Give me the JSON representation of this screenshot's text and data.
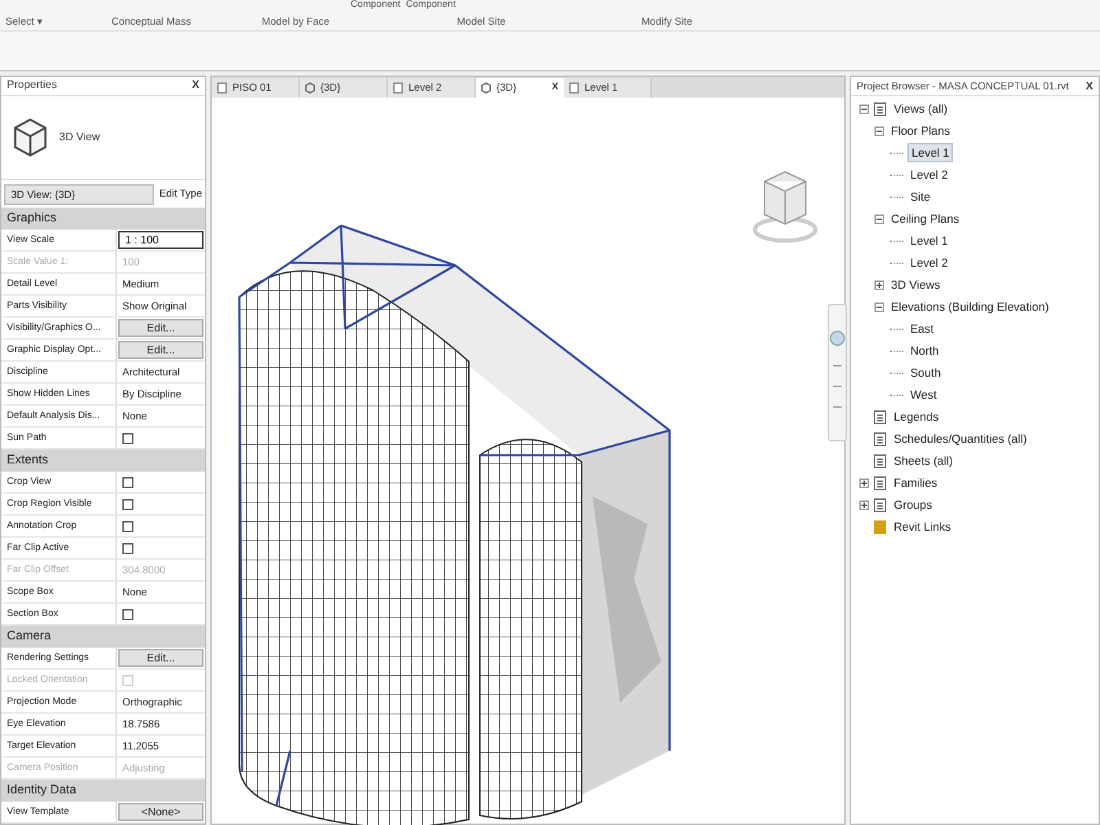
{
  "ribbon": {
    "top_labels": [
      "Component",
      "Component"
    ],
    "panels": [
      {
        "label": "Select ▾"
      },
      {
        "label": "Conceptual Mass"
      },
      {
        "label": "Model by Face"
      },
      {
        "label": "Model Site"
      },
      {
        "label": "Modify Site"
      }
    ]
  },
  "properties": {
    "title": "Properties",
    "close": "X",
    "type_name": "3D View",
    "selector": "3D View: {3D}",
    "edit_type": "Edit Type",
    "rows": [
      {
        "kind": "header",
        "label": "Graphics"
      },
      {
        "kind": "field",
        "label": "View Scale",
        "value": "1 : 100",
        "disabled": false
      },
      {
        "kind": "text",
        "label": "Scale Value  1:",
        "value": "100",
        "disabled": true
      },
      {
        "kind": "text",
        "label": "Detail Level",
        "value": "Medium",
        "disabled": false
      },
      {
        "kind": "text",
        "label": "Parts Visibility",
        "value": "Show Original",
        "disabled": false
      },
      {
        "kind": "button",
        "label": "Visibility/Graphics O...",
        "value": "Edit...",
        "disabled": false
      },
      {
        "kind": "button",
        "label": "Graphic Display Opt...",
        "value": "Edit...",
        "disabled": false
      },
      {
        "kind": "text",
        "label": "Discipline",
        "value": "Architectural",
        "disabled": false
      },
      {
        "kind": "text",
        "label": "Show Hidden Lines",
        "value": "By Discipline",
        "disabled": false
      },
      {
        "kind": "text",
        "label": "Default Analysis Dis...",
        "value": "None",
        "disabled": false
      },
      {
        "kind": "checkbox",
        "label": "Sun Path",
        "checked": false,
        "disabled": false
      },
      {
        "kind": "header",
        "label": "Extents"
      },
      {
        "kind": "checkbox",
        "label": "Crop View",
        "checked": false,
        "disabled": false
      },
      {
        "kind": "checkbox",
        "label": "Crop Region Visible",
        "checked": false,
        "disabled": false
      },
      {
        "kind": "checkbox",
        "label": "Annotation Crop",
        "checked": false,
        "disabled": false
      },
      {
        "kind": "checkbox",
        "label": "Far Clip Active",
        "checked": false,
        "disabled": false
      },
      {
        "kind": "text",
        "label": "Far Clip Offset",
        "value": "304.8000",
        "disabled": true
      },
      {
        "kind": "text",
        "label": "Scope Box",
        "value": "None",
        "disabled": false
      },
      {
        "kind": "checkbox",
        "label": "Section Box",
        "checked": false,
        "disabled": false
      },
      {
        "kind": "header",
        "label": "Camera"
      },
      {
        "kind": "button",
        "label": "Rendering Settings",
        "value": "Edit...",
        "disabled": false
      },
      {
        "kind": "checkbox",
        "label": "Locked Orientation",
        "checked": false,
        "disabled": true
      },
      {
        "kind": "text",
        "label": "Projection Mode",
        "value": "Orthographic",
        "disabled": false
      },
      {
        "kind": "text",
        "label": "Eye Elevation",
        "value": "18.7586",
        "disabled": false
      },
      {
        "kind": "text",
        "label": "Target Elevation",
        "value": "11.2055",
        "disabled": false
      },
      {
        "kind": "text",
        "label": "Camera Position",
        "value": "Adjusting",
        "disabled": true
      },
      {
        "kind": "header",
        "label": "Identity Data"
      },
      {
        "kind": "button",
        "label": "View Template",
        "value": "<None>",
        "disabled": false
      }
    ]
  },
  "view_tabs": [
    {
      "label": "PISO 01",
      "kind": "plan",
      "selected": false
    },
    {
      "label": "{3D}",
      "kind": "view3d",
      "selected": false
    },
    {
      "label": "Level 2",
      "kind": "plan",
      "selected": false
    },
    {
      "label": "{3D}",
      "kind": "view3d",
      "selected": true
    },
    {
      "label": "Level 1",
      "kind": "plan",
      "selected": false
    }
  ],
  "tab_close": "X",
  "project_browser": {
    "title": "Project Browser - MASA CONCEPTUAL 01.rvt",
    "close": "X",
    "tree": [
      {
        "label": "Views (all)",
        "expanded": true,
        "selected": false,
        "children": [
          {
            "label": "Floor Plans",
            "expanded": true,
            "selected": false,
            "children": [
              {
                "label": "Level 1",
                "selected": true
              },
              {
                "label": "Level 2",
                "selected": false
              },
              {
                "label": "Site",
                "selected": false
              }
            ]
          },
          {
            "label": "Ceiling Plans",
            "expanded": true,
            "selected": false,
            "children": [
              {
                "label": "Level 1",
                "selected": false
              },
              {
                "label": "Level 2",
                "selected": false
              }
            ]
          },
          {
            "label": "3D Views",
            "expanded": false,
            "selected": false
          },
          {
            "label": "Elevations (Building Elevation)",
            "expanded": true,
            "selected": false,
            "children": [
              {
                "label": "East",
                "selected": false
              },
              {
                "label": "North",
                "selected": false
              },
              {
                "label": "South",
                "selected": false
              },
              {
                "label": "West",
                "selected": false
              }
            ]
          }
        ]
      },
      {
        "label": "Legends",
        "selected": false
      },
      {
        "label": "Schedules/Quantities (all)",
        "selected": false
      },
      {
        "label": "Sheets (all)",
        "selected": false
      },
      {
        "label": "Families",
        "expanded": false,
        "selected": false
      },
      {
        "label": "Groups",
        "expanded": false,
        "selected": false
      },
      {
        "label": "Revit Links",
        "selected": false
      }
    ]
  }
}
